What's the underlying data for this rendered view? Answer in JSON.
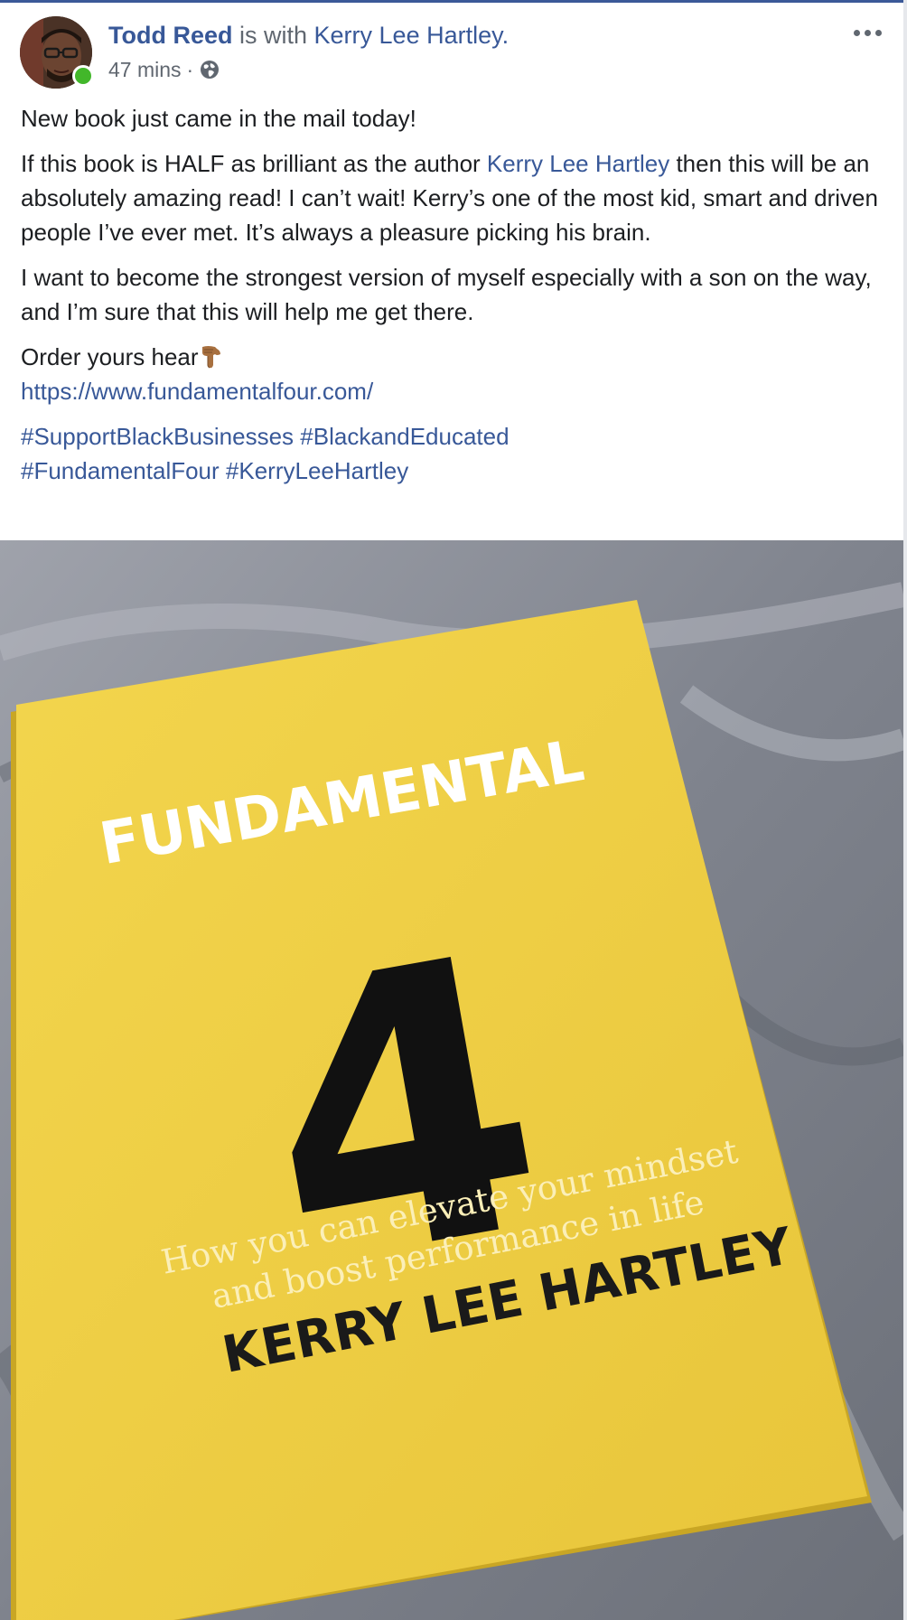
{
  "post": {
    "author": "Todd Reed",
    "with_text": " is with ",
    "tagged": "Kerry Lee Hartley.",
    "timestamp": "47 mins",
    "separator": "·",
    "privacy_icon": "globe-icon",
    "more_icon": "ellipsis-icon",
    "online_status_color": "#42b72a",
    "link_color": "#385898"
  },
  "body": {
    "para1": "New book just came in the mail today!",
    "para2_before": "If this book is HALF as brilliant as the author ",
    "para2_link": "Kerry Lee Hartley",
    "para2_after": " then this will be an absolutely amazing read! I can’t wait! Kerry’s one of the most kid, smart and driven people I’ve ever met. It’s always a pleasure picking his brain.",
    "para3": "I want to become the strongest version of myself especially with a son on the way, and I’m sure that this will help me get there.",
    "para4_text": "Order yours hear",
    "para4_emoji": "pointing-down-emoji",
    "url": "https://www.fundamentalfour.com/",
    "hashtags": [
      "#SupportBlackBusinesses",
      "#BlackandEducated",
      "#FundamentalFour",
      "#KerryLeeHartley"
    ]
  },
  "photo": {
    "book_title": "FUNDAMENTAL",
    "book_number": "4",
    "subtitle_line1": "How you can elevate your mindset",
    "subtitle_line2": "and boost performance in life",
    "book_author": "KERRY LEE HARTLEY",
    "cover_color": "#f0cf45"
  }
}
